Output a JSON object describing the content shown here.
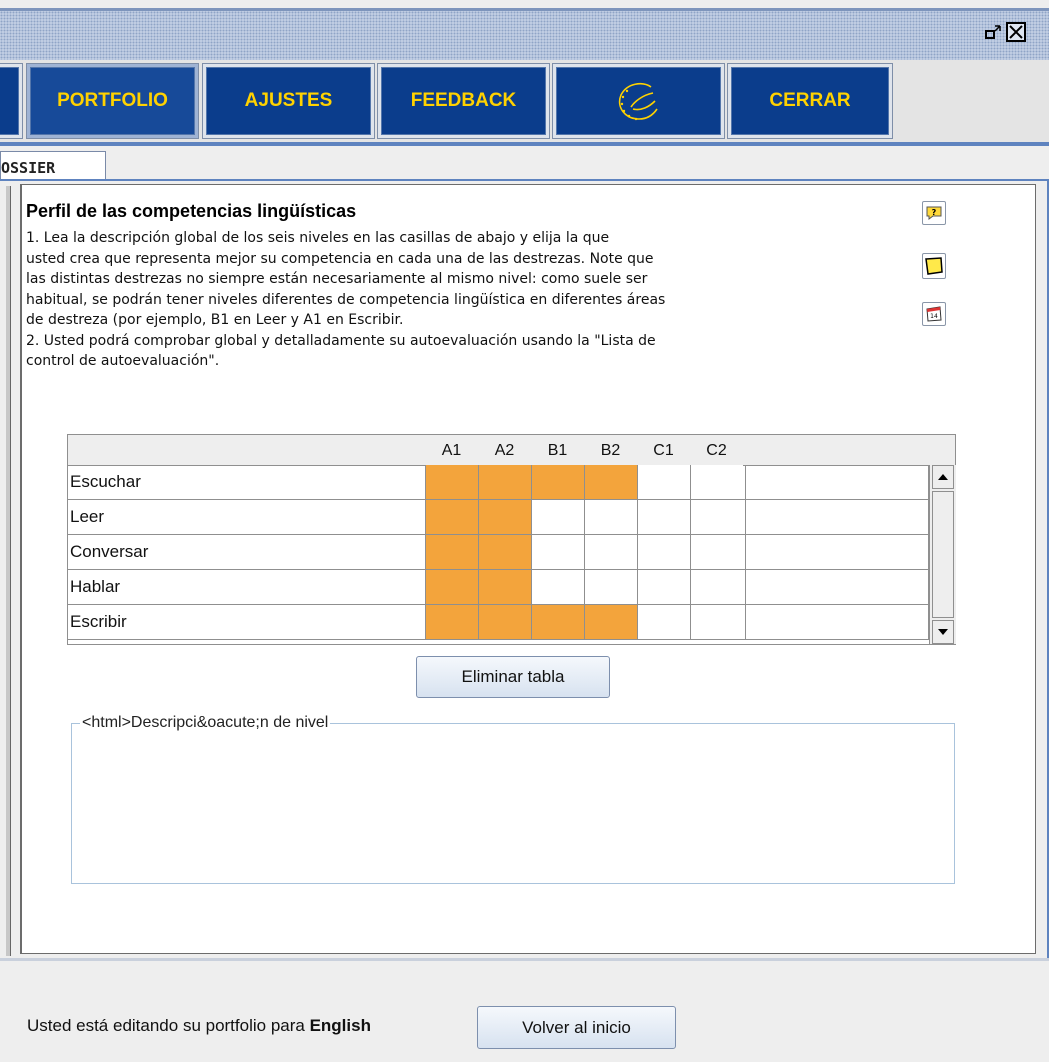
{
  "window": {
    "controls": [
      {
        "name": "restore-icon"
      },
      {
        "name": "close-icon"
      }
    ]
  },
  "nav": {
    "items": [
      {
        "label": "PORTFOLIO"
      },
      {
        "label": "AJUSTES"
      },
      {
        "label": "FEEDBACK"
      },
      {
        "label": "",
        "icon": "council-of-europe-logo"
      },
      {
        "label": "CERRAR"
      }
    ]
  },
  "tabs": {
    "active": "OSSIER"
  },
  "section": {
    "heading": "Perfil de las competencias lingüísticas",
    "instructions": "1. Lea la descripción global de los seis niveles en las casillas de abajo y elija la que\nusted crea que representa mejor su competencia en cada una de las destrezas. Note que\nlas distintas destrezas no siempre están necesariamente al mismo nivel: como suele ser\nhabitual, se podrán tener niveles diferentes de competencia lingüística en diferentes áreas\nde destreza (por ejemplo, B1 en Leer y A1 en Escribir.\n2. Usted podrá comprobar global y detalladamente su autoevaluación usando la \"Lista de\ncontrol de autoevaluación\".",
    "side_buttons": [
      "help-icon",
      "note-icon",
      "calendar-icon"
    ],
    "calendar_day": "14"
  },
  "levels": {
    "columns": [
      "A1",
      "A2",
      "B1",
      "B2",
      "C1",
      "C2"
    ],
    "rows": [
      {
        "skill": "Escuchar",
        "filled": 4
      },
      {
        "skill": "Leer",
        "filled": 2
      },
      {
        "skill": "Conversar",
        "filled": 2
      },
      {
        "skill": "Hablar",
        "filled": 2
      },
      {
        "skill": "Escribir",
        "filled": 4
      }
    ],
    "highlight_color": "#f3a43c"
  },
  "buttons": {
    "delete_table": "Eliminar tabla",
    "back_home": "Volver al inicio"
  },
  "description": {
    "legend": "<html>Descripci&oacute;n de nivel"
  },
  "status": {
    "prefix": "Usted está editando su portfolio para",
    "language": "English"
  }
}
